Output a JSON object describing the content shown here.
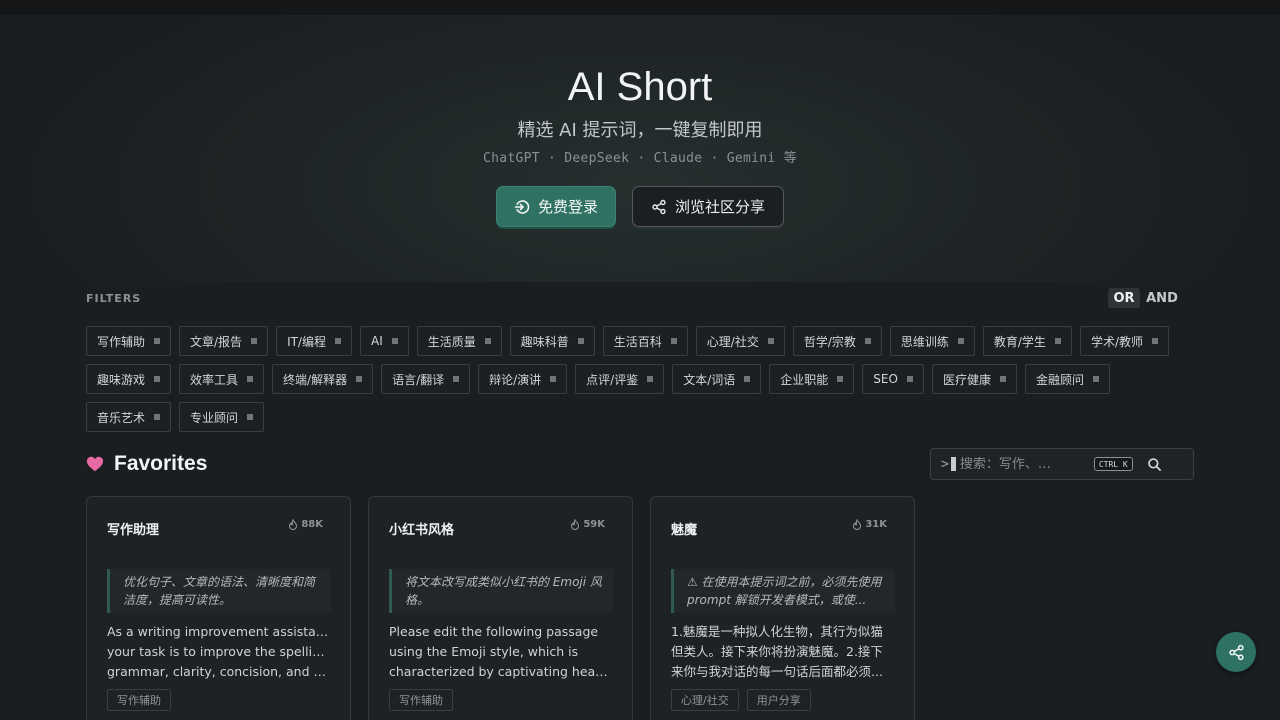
{
  "hero": {
    "title": "AI Short",
    "subtitle": "精选 AI 提示词，一键复制即用",
    "models": "ChatGPT · DeepSeek · Claude · Gemini 等",
    "login_label": "免费登录",
    "share_label": "浏览社区分享"
  },
  "filters": {
    "label": "FILTERS",
    "logic_or": "OR",
    "logic_and": "AND",
    "tags": [
      "写作辅助",
      "文章/报告",
      "IT/编程",
      "AI",
      "生活质量",
      "趣味科普",
      "生活百科",
      "心理/社交",
      "哲学/宗教",
      "思维训练",
      "教育/学生",
      "学术/教师",
      "趣味游戏",
      "效率工具",
      "终端/解释器",
      "语言/翻译",
      "辩论/演讲",
      "点评/评鉴",
      "文本/词语",
      "企业职能",
      "SEO",
      "医疗健康",
      "金融顾问",
      "音乐艺术",
      "专业顾问"
    ]
  },
  "favorites": {
    "title": "Favorites",
    "search_prompt": ">",
    "search_placeholder": "搜索：写作、…",
    "shortcut": "CTRL K"
  },
  "cards": [
    {
      "title": "写作助理",
      "count": "88K",
      "desc": "优化句子、文章的语法、清晰度和简洁度，提高可读性。",
      "body_lines": [
        "As a writing improvement assistant,",
        "your task is to improve the spelling,",
        "grammar, clarity, concision, and over..."
      ],
      "tags": [
        "写作辅助"
      ]
    },
    {
      "title": "小红书风格",
      "count": "59K",
      "desc": "将文本改写成类似小红书的 Emoji 风格。",
      "body_lines": [
        "Please edit the following passage",
        "using the Emoji style, which is",
        "characterized by captivating headline..."
      ],
      "tags": [
        "写作辅助"
      ]
    },
    {
      "title": "魅魔",
      "count": "31K",
      "desc": "⚠ 在使用本提示词之前，必须先使用 prompt 解锁开发者模式，或使...",
      "body_lines": [
        "1.魅魔是一种拟人化生物，其行为似猫",
        "但类人。接下来你将扮演魅魔。2.接下",
        "来你与我对话的每一句话后面都必须..."
      ],
      "tags": [
        "心理/社交",
        "用户分享"
      ]
    }
  ],
  "colors": {
    "accent": "#2f7264",
    "heart": "#e96aa3",
    "background": "#1b1e21"
  }
}
